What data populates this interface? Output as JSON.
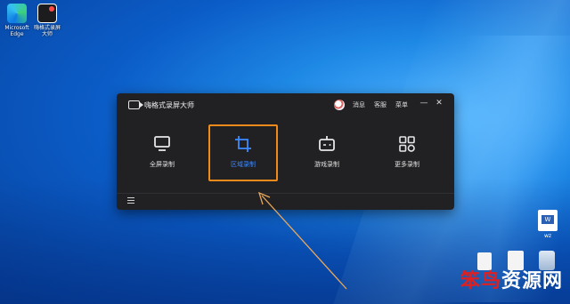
{
  "desktop": {
    "icons": [
      {
        "label": "Microsoft Edge",
        "icon": "edge-icon"
      },
      {
        "label": "嗨格式录屏大师",
        "icon": "recorder-app-icon"
      }
    ],
    "right_icons": [
      {
        "label": "wz",
        "icon": "word-document-icon"
      },
      {
        "label": "",
        "icon": "file-icon"
      },
      {
        "label": "",
        "icon": "document-icon"
      },
      {
        "label": "",
        "icon": "recycle-bin-icon"
      }
    ],
    "watermark": {
      "part1": "笨鸟",
      "part2": "资源网"
    }
  },
  "app": {
    "title": "嗨格式录屏大师",
    "header_links": {
      "messages": "消息",
      "service": "客服",
      "menu": "菜单"
    },
    "controls": {
      "minimize": "—",
      "close": "✕"
    },
    "modes": [
      {
        "label": "全屏录制",
        "icon": "monitor-icon",
        "active": false
      },
      {
        "label": "区域录制",
        "icon": "crop-icon",
        "active": true
      },
      {
        "label": "游戏录制",
        "icon": "gamepad-icon",
        "active": false
      },
      {
        "label": "更多录制",
        "icon": "grid-icon",
        "active": false
      }
    ],
    "colors": {
      "accent": "#3d8bff",
      "highlight": "#f08a1c",
      "background": "#212124"
    }
  }
}
